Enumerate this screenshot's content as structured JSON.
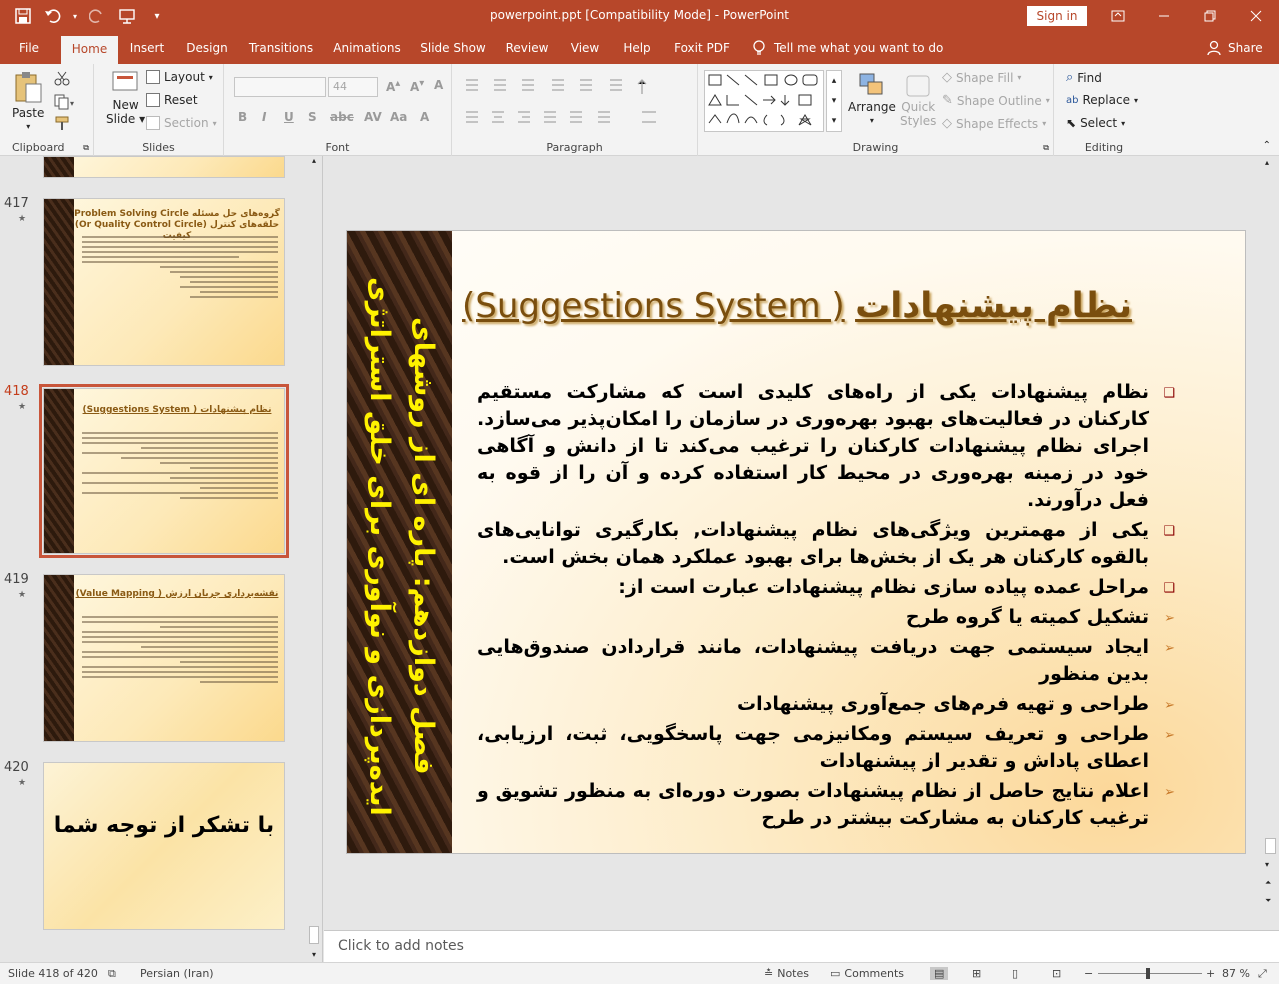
{
  "window": {
    "title": "powerpoint.ppt [Compatibility Mode]  -  PowerPoint",
    "sign_in": "Sign in"
  },
  "tabs": [
    "File",
    "Home",
    "Insert",
    "Design",
    "Transitions",
    "Animations",
    "Slide Show",
    "Review",
    "View",
    "Help",
    "Foxit PDF"
  ],
  "active_tab": "Home",
  "tell_me": "Tell me what you want to do",
  "share": "Share",
  "ribbon": {
    "clipboard": {
      "label": "Clipboard",
      "paste": "Paste"
    },
    "slides": {
      "label": "Slides",
      "new_slide": "New",
      "new_slide2": "Slide",
      "layout": "Layout",
      "reset": "Reset",
      "section": "Section"
    },
    "font": {
      "label": "Font",
      "size": "44"
    },
    "paragraph": {
      "label": "Paragraph"
    },
    "drawing": {
      "label": "Drawing",
      "arrange": "Arrange",
      "quick_styles": "Quick",
      "quick_styles2": "Styles",
      "shape_fill": "Shape Fill",
      "shape_outline": "Shape Outline",
      "shape_effects": "Shape Effects"
    },
    "editing": {
      "label": "Editing",
      "find": "Find",
      "replace": "Replace",
      "select": "Select"
    }
  },
  "thumbnails": [
    {
      "num": "417",
      "title1": "Problem Solving Circle گروه‌های حل مسئله",
      "title2": "(Or Quality Control Circle) حلقه‌های کنترل کیفیت"
    },
    {
      "num": "418",
      "title1": "(Suggestions System )   نظام پیشنهادات",
      "title2": ""
    },
    {
      "num": "419",
      "title1": "(Value Mapping )   نقشه‌برداری جریان ارزش",
      "title2": ""
    },
    {
      "num": "420",
      "title1": "با تشکر از توجه شما",
      "title2": ""
    }
  ],
  "slide": {
    "side_text": "فصل دوازدهم: پاره ای از روشهای ایده‌پردازی و نوآوری برای خلق استراتژی",
    "title_fa": "نظام پیشنهادات",
    "title_en": "(Suggestions System )",
    "bullets": [
      {
        "type": "square",
        "text": "نظام پیشنهادات یکی از راه‌های کلیدی است که مشارکت مستقیم کارکنان در فعالیت‌های بهبود بهره‌وری در سازمان را امکان‌پذیر می‌سازد. اجرای نظام پیشنهادات کارکنان را ترغیب می‌کند تا از دانش و آگاهی خود در زمینه بهره‌وری در محیط کار استفاده کرده و آن را از قوه به فعل درآورند."
      },
      {
        "type": "square",
        "text": "یکی از مهمترین ویژگی‌های نظام پیشنهادات, بکارگیری توانایی‌های بالقوه کارکنان هر یک از بخش‌ها برای بهبود عملکرد همان بخش است."
      },
      {
        "type": "square",
        "text": " مراحل عمده پیاده سازی نظام پیشنهادات عبارت است از:"
      },
      {
        "type": "arrow",
        "text": "تشکیل کمیته یا گروه طرح"
      },
      {
        "type": "arrow",
        "text": "ایجاد سیستمی جهت دریافت پیشنهادات، مانند قراردادن صندوق‌هایی بدین منظور"
      },
      {
        "type": "arrow",
        "text": "طراحی و تهیه فرم‌های جمع‌آوری پیشنهادات"
      },
      {
        "type": "arrow",
        "text": "طراحی و تعریف سیستم ومکانیزمی جهت پاسخگویی، ثبت، ارزیابی، اعطای پاداش و تقدیر از پیشنهادات"
      },
      {
        "type": "arrow",
        "text": "اعلام نتایج حاصل از نظام پیشنهادات بصورت دوره‌ای به منظور تشویق و ترغیب کارکنان به مشارکت بیشتر در طرح"
      }
    ]
  },
  "notes_placeholder": "Click to add notes",
  "status": {
    "slide_info": "Slide 418 of 420",
    "language": "Persian (Iran)",
    "notes": "Notes",
    "comments": "Comments",
    "zoom": "87 %"
  }
}
